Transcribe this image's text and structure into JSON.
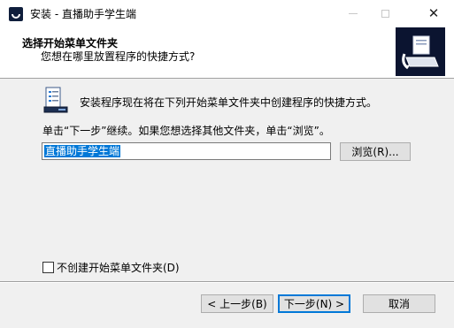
{
  "window": {
    "title": "安装 - 直播助手学生端",
    "close_glyph": "✕"
  },
  "header": {
    "title": "选择开始菜单文件夹",
    "subtitle": "您想在哪里放置程序的快捷方式?"
  },
  "body": {
    "info_text": "安装程序现在将在下列开始菜单文件夹中创建程序的快捷方式。",
    "instruction_text": "单击“下一步”继续。如果您想选择其他文件夹，单击“浏览”。",
    "folder_value": "直播助手学生端",
    "browse_label": "浏览(R)...",
    "no_folder_label": "不创建开始菜单文件夹(D)"
  },
  "footer": {
    "back_label": "< 上一步(B)",
    "next_label": "下一步(N) >",
    "cancel_label": "取消"
  },
  "colors": {
    "selection": "#0078d7",
    "button_face": "#e1e1e1",
    "header_graphic_bg": "#0b1430"
  }
}
